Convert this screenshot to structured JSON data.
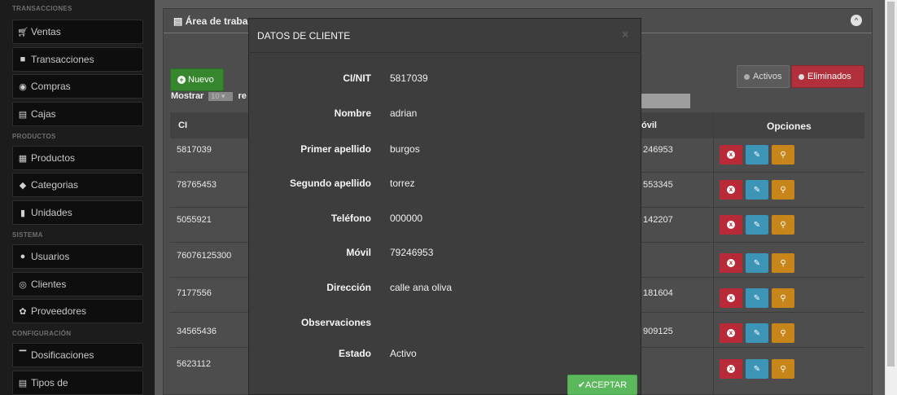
{
  "sidebar": {
    "sections": [
      "TRANSACCIONES",
      "PRODUCTOS",
      "SISTEMA",
      "CONFIGURACIÓN"
    ],
    "items": [
      {
        "label": "Ventas",
        "icon": "cart-icon"
      },
      {
        "label": "Transacciones",
        "icon": "book-icon"
      },
      {
        "label": "Compras",
        "icon": "globe-icon"
      },
      {
        "label": "Cajas",
        "icon": "briefcase-icon"
      },
      {
        "label": "Productos",
        "icon": "group-icon"
      },
      {
        "label": "Categorias",
        "icon": "tags-icon"
      },
      {
        "label": "Unidades",
        "icon": "bookmark-icon"
      },
      {
        "label": "Usuarios",
        "icon": "user-icon"
      },
      {
        "label": "Clientes",
        "icon": "eye-icon"
      },
      {
        "label": "Proveedores",
        "icon": "leaf-icon"
      },
      {
        "label": "Dosificaciones",
        "icon": "bank-icon"
      },
      {
        "label": "Tipos de",
        "icon": "list-icon"
      }
    ]
  },
  "panel": {
    "title": "Área de traba",
    "nuevo_label": "Nuevo",
    "mostrar_label": "Mostrar",
    "mostrar_value": "10",
    "mostrar_suffix": "re",
    "activos_label": "Activos",
    "eliminados_label": "Eliminados"
  },
  "table": {
    "headers": {
      "ci": "CI",
      "movil": "óvil",
      "opciones": "Opciones"
    },
    "rows": [
      {
        "ci": "5817039",
        "movil": "246953"
      },
      {
        "ci": "78765453",
        "movil": "553345"
      },
      {
        "ci": "5055921",
        "movil": "142207"
      },
      {
        "ci": "76076125300",
        "movil": ""
      },
      {
        "ci": "7177556",
        "movil": "181604"
      },
      {
        "ci": "34565436",
        "movil": "909125"
      },
      {
        "ci": "5623112",
        "movil": ""
      }
    ]
  },
  "modal": {
    "title": "DATOS DE CLIENTE",
    "close_label": "×",
    "fields": [
      {
        "label": "CI/NIT",
        "value": "5817039"
      },
      {
        "label": "Nombre",
        "value": "adrian"
      },
      {
        "label": "Primer apellido",
        "value": "burgos"
      },
      {
        "label": "Segundo apellido",
        "value": "torrez"
      },
      {
        "label": "Teléfono",
        "value": "000000"
      },
      {
        "label": "Móvil",
        "value": "79246953"
      },
      {
        "label": "Dirección",
        "value": "calle ana oliva"
      },
      {
        "label": "Observaciones",
        "value": ""
      },
      {
        "label": "Estado",
        "value": "Activo"
      }
    ],
    "ok_label": "ACEPTAR"
  },
  "colors": {
    "sidebar_bg": "#1c1c1c",
    "modal_bg": "#3d3d3d",
    "success": "#5cb85c",
    "danger": "#b82a37",
    "info": "#3c95b7",
    "warning": "#c8861a"
  }
}
